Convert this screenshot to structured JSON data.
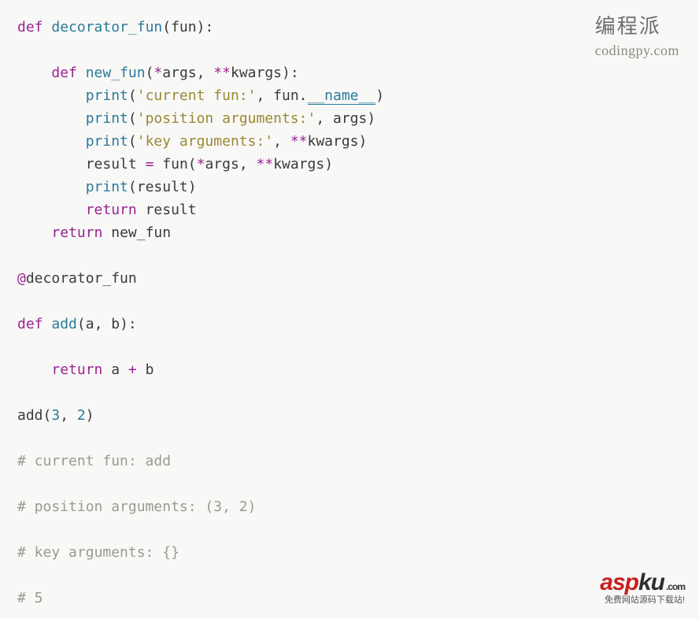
{
  "watermark_top": {
    "zh": "编程派",
    "en": "codingpy.com"
  },
  "watermark_bottom": {
    "asp": "asp",
    "ku": "ku",
    "dotcom": ".com",
    "sub": "免费网站源码下载站!"
  },
  "code": {
    "l01": {
      "def": "def",
      "name": "decorator_fun",
      "lp": "(",
      "p1": "fun",
      "rp": "):"
    },
    "l03": {
      "def": "def",
      "name": "new_fun",
      "lp": "(",
      "star1": "*",
      "p1": "args",
      "comma": ", ",
      "star2": "**",
      "p2": "kwargs",
      "rp": "):"
    },
    "l04": {
      "fn": "print",
      "lp": "(",
      "s": "'current fun:'",
      "comma": ", ",
      "obj": "fun",
      "dot": ".",
      "dunder": "__name__",
      "rp": ")"
    },
    "l05": {
      "fn": "print",
      "lp": "(",
      "s": "'position arguments:'",
      "comma": ", ",
      "arg": "args",
      "rp": ")"
    },
    "l06": {
      "fn": "print",
      "lp": "(",
      "s": "'key arguments:'",
      "comma": ", ",
      "star": "**",
      "arg": "kwargs",
      "rp": ")"
    },
    "l07": {
      "res": "result",
      "sp1": " ",
      "eq": "=",
      "sp2": " ",
      "fn": "fun",
      "lp": "(",
      "star1": "*",
      "a1": "args",
      "comma": ", ",
      "star2": "**",
      "a2": "kwargs",
      "rp": ")"
    },
    "l08": {
      "fn": "print",
      "lp": "(",
      "arg": "result",
      "rp": ")"
    },
    "l09": {
      "ret": "return",
      "sp": " ",
      "val": "result"
    },
    "l10": {
      "ret": "return",
      "sp": " ",
      "val": "new_fun"
    },
    "l12": {
      "at": "@",
      "name": "decorator_fun"
    },
    "l14": {
      "def": "def",
      "name": "add",
      "lp": "(",
      "p1": "a",
      "comma": ", ",
      "p2": "b",
      "rp": "):"
    },
    "l16": {
      "ret": "return",
      "sp": " ",
      "a": "a",
      "sp2": " ",
      "op": "+",
      "sp3": " ",
      "b": "b"
    },
    "l18": {
      "fn": "add",
      "lp": "(",
      "n1": "3",
      "comma": ", ",
      "n2": "2",
      "rp": ")"
    },
    "c1": "# current fun: add",
    "c2": "# position arguments: (3, 2)",
    "c3": "# key arguments: {}",
    "c4": "# 5"
  }
}
